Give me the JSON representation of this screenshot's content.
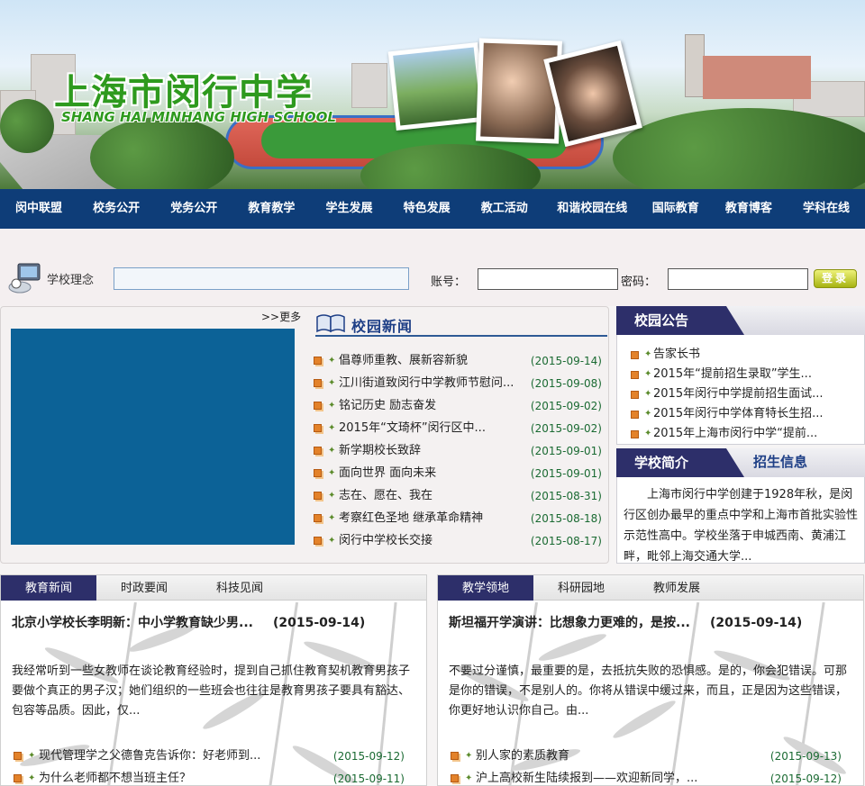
{
  "header": {
    "title_cn": "上海市闵行中学",
    "title_en": "SHANG HAI MINHANG HIGH SCHOOL"
  },
  "nav": [
    "闵中联盟",
    "校务公开",
    "党务公开",
    "教育教学",
    "学生发展",
    "特色发展",
    "教工活动",
    "和谐校园在线",
    "国际教育",
    "教育博客",
    "学科在线"
  ],
  "login": {
    "motto_label": "学校理念",
    "account_label": "账号：",
    "password_label": "密码：",
    "login_button": "登录"
  },
  "slideshow": {
    "more_label": ">>更多"
  },
  "campus_news": {
    "title": "校园新闻",
    "items": [
      {
        "title": "倡尊师重教、展新容新貌",
        "date": "(2015-09-14)"
      },
      {
        "title": "江川街道致闵行中学教师节慰问...",
        "date": "(2015-09-08)"
      },
      {
        "title": "铭记历史 励志奋发",
        "date": "(2015-09-02)"
      },
      {
        "title": "2015年“文琦杯”闵行区中...",
        "date": "(2015-09-02)"
      },
      {
        "title": "新学期校长致辞",
        "date": "(2015-09-01)"
      },
      {
        "title": "面向世界 面向未来",
        "date": "(2015-09-01)"
      },
      {
        "title": "志在、愿在、我在",
        "date": "(2015-08-31)"
      },
      {
        "title": "考察红色圣地 继承革命精神",
        "date": "(2015-08-18)"
      },
      {
        "title": "闵行中学校长交接",
        "date": "(2015-08-17)"
      }
    ]
  },
  "notices": {
    "title": "校园公告",
    "items": [
      "告家长书",
      "2015年“提前招生录取”学生...",
      "2015年闵行中学提前招生面试...",
      "2015年闵行中学体育特长生招...",
      "2015年上海市闵行中学“提前..."
    ]
  },
  "intro": {
    "tab_active": "学校简介",
    "tab_other": "招生信息",
    "text": "上海市闵行中学创建于1928年秋，是闵行区创办最早的重点中学和上海市首批实验性示范性高中。学校坐落于申城西南、黄浦江畔，毗邻上海交通大学..."
  },
  "left_bottom": {
    "tabs": [
      "教育新闻",
      "时政要闻",
      "科技见闻"
    ],
    "headline": "北京小学校长李明新：中小学教育缺少男...",
    "headline_date": "(2015-09-14)",
    "body": "我经常听到一些女教师在谈论教育经验时，提到自己抓住教育契机教育男孩子要做个真正的男子汉；她们组织的一些班会也往往是教育男孩子要具有豁达、包容等品质。因此，仅...",
    "items": [
      {
        "title": "现代管理学之父德鲁克告诉你：好老师到...",
        "date": "(2015-09-12)"
      },
      {
        "title": "为什么老师都不想当班主任？",
        "date": "(2015-09-11)"
      }
    ]
  },
  "right_bottom": {
    "tabs": [
      "教学领地",
      "科研园地",
      "教师发展"
    ],
    "headline": "斯坦福开学演讲：比想象力更难的，是按...",
    "headline_date": "(2015-09-14)",
    "body": "不要过分谨慎，最重要的是，去抵抗失败的恐惧感。是的，你会犯错误。可那是你的错误，不是别人的。你将从错误中缓过来，而且，正是因为这些错误，你更好地认识你自己。由...",
    "items": [
      {
        "title": "别人家的素质教育",
        "date": "(2015-09-13)"
      },
      {
        "title": "沪上高校新生陆续报到——欢迎新同学，...",
        "date": "(2015-09-12)"
      }
    ]
  },
  "colors": {
    "nav_bg": "#0e3d78",
    "tab_dark": "#2d2f6a",
    "title_green": "#2e9a1e",
    "slide_blue": "#0c6297",
    "date_green": "#1a6a32"
  }
}
